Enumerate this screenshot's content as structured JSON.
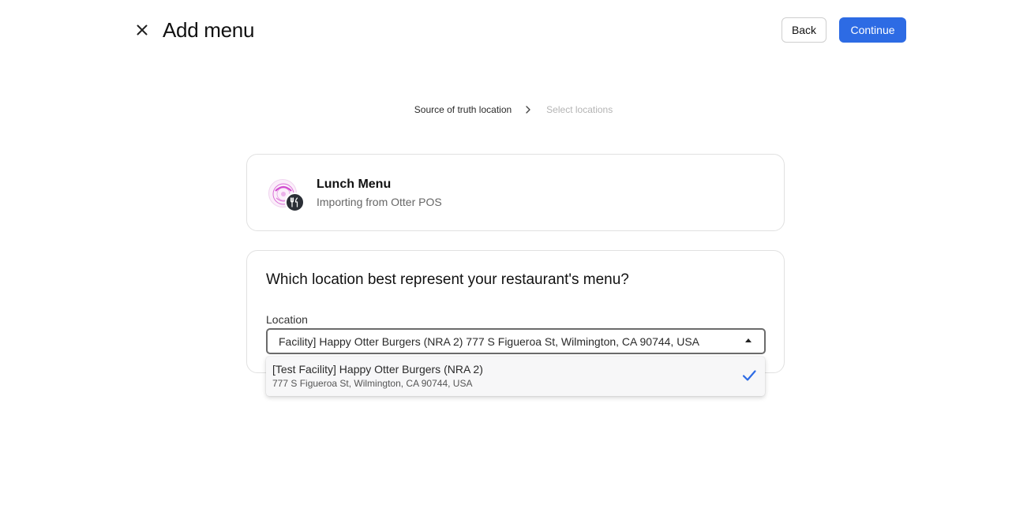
{
  "header": {
    "title": "Add menu",
    "back_label": "Back",
    "continue_label": "Continue",
    "close_icon": "close-icon"
  },
  "stepper": {
    "steps": [
      {
        "label": "Source of truth location",
        "state": "active"
      },
      {
        "label": "Select locations",
        "state": "inactive"
      }
    ]
  },
  "menu_card": {
    "name": "Lunch Menu",
    "subtitle": "Importing from Otter POS",
    "avatar_icon": "restaurant-logo",
    "badge_icon": "fork-knife-icon"
  },
  "location_card": {
    "question": "Which location best represent your restaurant's menu?",
    "field_label": "Location",
    "selected_value": "Facility] Happy Otter Burgers (NRA 2) 777 S Figueroa St, Wilmington, CA 90744, USA"
  },
  "dropdown": {
    "options": [
      {
        "title": "[Test Facility] Happy Otter Burgers (NRA 2)",
        "subtitle": "777 S Figueroa St, Wilmington, CA 90744, USA",
        "selected": true
      }
    ]
  },
  "colors": {
    "accent": "#2d6be4",
    "badge": "#2b2f36",
    "check": "#2d6be4"
  }
}
